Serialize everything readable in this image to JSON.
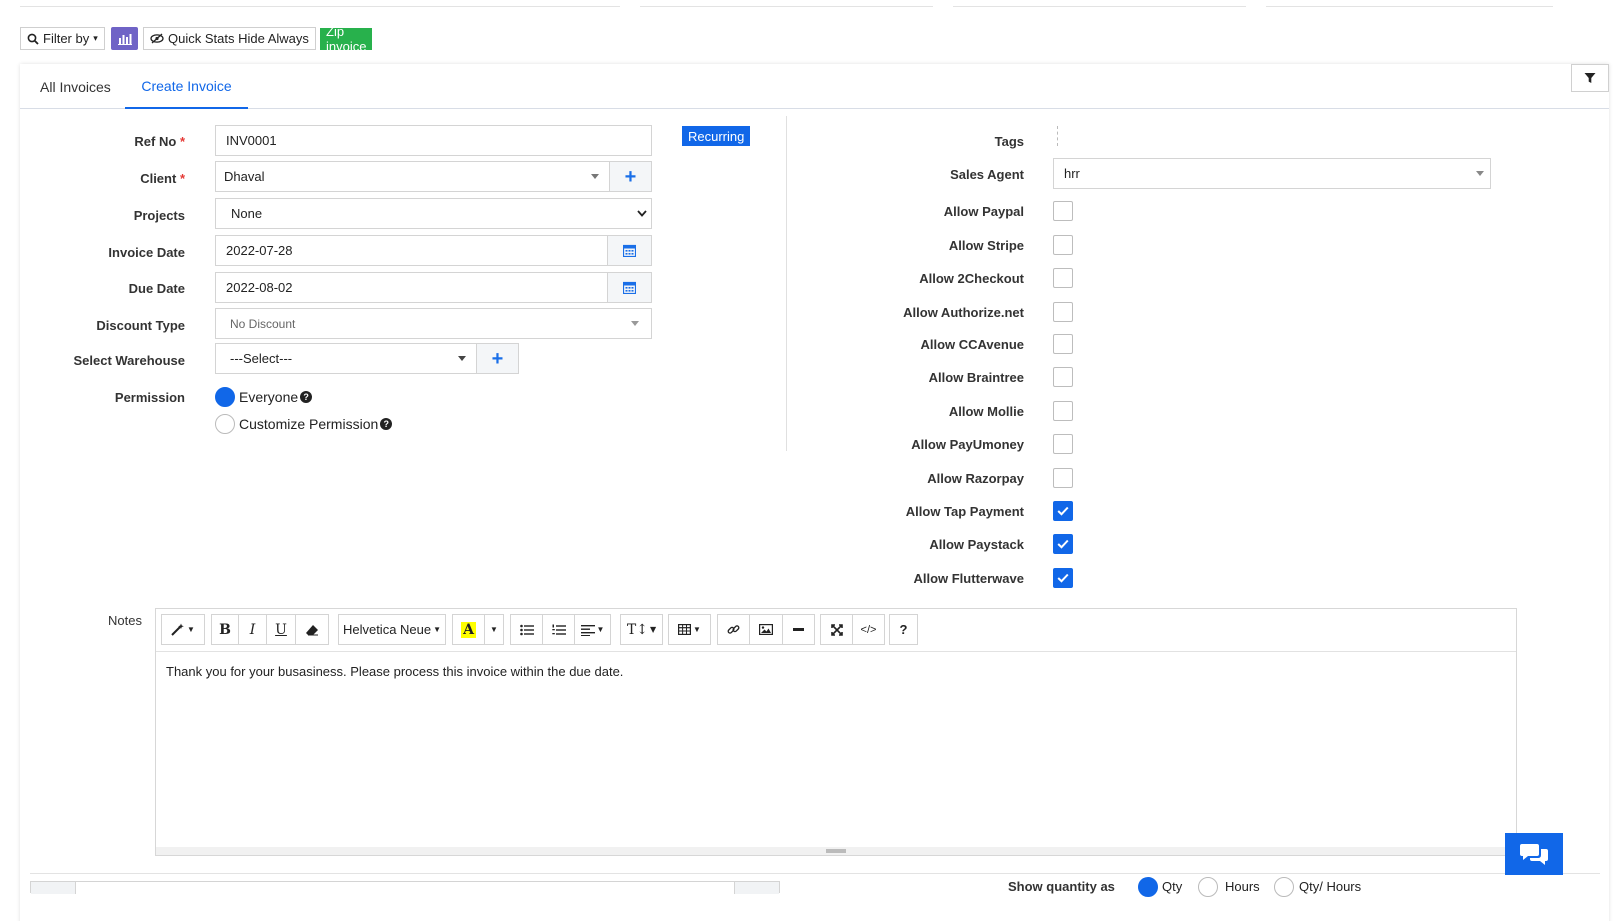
{
  "toolbar": {
    "filter_label": "Filter by",
    "quick_stats_label": "Quick Stats Hide Always",
    "zip_label": "Zip invoice"
  },
  "tabs": [
    {
      "label": "All Invoices"
    },
    {
      "label": "Create Invoice"
    }
  ],
  "form": {
    "ref_no": {
      "label": "Ref No",
      "value": "INV0001"
    },
    "recurring_label": "Recurring",
    "client": {
      "label": "Client",
      "value": "Dhaval"
    },
    "projects": {
      "label": "Projects",
      "value": "None"
    },
    "invoice_date": {
      "label": "Invoice Date",
      "value": "2022-07-28"
    },
    "due_date": {
      "label": "Due Date",
      "value": "2022-08-02"
    },
    "discount_type": {
      "label": "Discount Type",
      "value": "No Discount"
    },
    "warehouse": {
      "label": "Select Warehouse",
      "value": "---Select---"
    },
    "permission": {
      "label": "Permission",
      "options": [
        {
          "label": "Everyone",
          "selected": true
        },
        {
          "label": "Customize Permission",
          "selected": false
        }
      ]
    },
    "required_mark": "*"
  },
  "right_panel": {
    "tags_label": "Tags",
    "sales_agent": {
      "label": "Sales Agent",
      "value": "hrr"
    },
    "gateways": [
      {
        "label": "Allow Paypal",
        "checked": false
      },
      {
        "label": "Allow Stripe",
        "checked": false
      },
      {
        "label": "Allow 2Checkout",
        "checked": false
      },
      {
        "label": "Allow Authorize.net",
        "checked": false
      },
      {
        "label": "Allow CCAvenue",
        "checked": false
      },
      {
        "label": "Allow Braintree",
        "checked": false
      },
      {
        "label": "Allow Mollie",
        "checked": false
      },
      {
        "label": "Allow PayUmoney",
        "checked": false
      },
      {
        "label": "Allow Razorpay",
        "checked": false
      },
      {
        "label": "Allow Tap Payment",
        "checked": true
      },
      {
        "label": "Allow Paystack",
        "checked": true
      },
      {
        "label": "Allow Flutterwave",
        "checked": true
      }
    ]
  },
  "notes": {
    "label": "Notes",
    "font_name": "Helvetica Neue",
    "content": "Thank you for your busasiness. Please process this invoice within the due date."
  },
  "bottom": {
    "show_quantity_label": "Show quantity as",
    "options": [
      {
        "label": "Qty",
        "selected": true
      },
      {
        "label": "Hours",
        "selected": false
      },
      {
        "label": "Qty/ Hours",
        "selected": false
      }
    ]
  },
  "colors": {
    "accent": "#1167e8",
    "zip_green": "#28b14c",
    "stats_purple": "#6f63c6",
    "required_red": "#e53935"
  }
}
